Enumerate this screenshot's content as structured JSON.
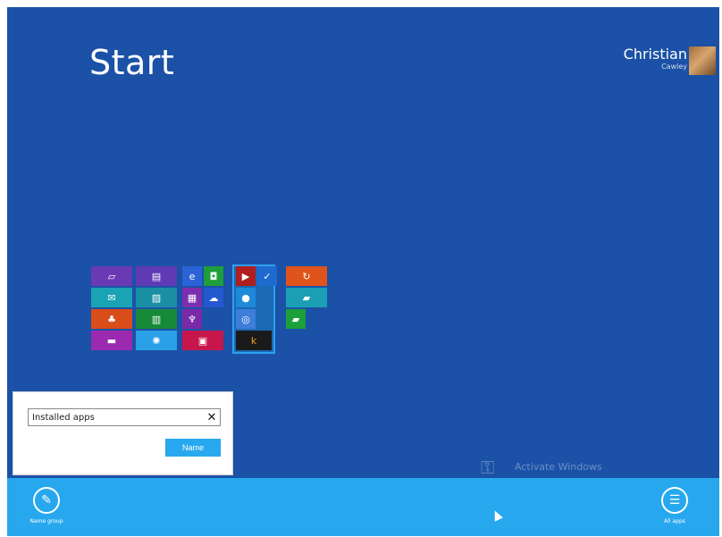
{
  "screen": {
    "title": "Start"
  },
  "user": {
    "name": "Christian",
    "subtitle": "Cawley"
  },
  "tiles": [
    {
      "name": "tile-photos",
      "color": "#6a3ab5",
      "glyph": "▱"
    },
    {
      "name": "tile-news",
      "color": "#5f3ab5",
      "glyph": "▤"
    },
    {
      "name": "tile-ie",
      "color": "#2b63d6",
      "glyph": "e"
    },
    {
      "name": "tile-store",
      "color": "#1e9e3a",
      "glyph": "◘"
    },
    {
      "name": "tile-mail",
      "color": "#1aa3b5",
      "glyph": "✉"
    },
    {
      "name": "tile-photos2",
      "color": "#1a8fa3",
      "glyph": "▨"
    },
    {
      "name": "tile-people",
      "color": "#7b2eb0",
      "glyph": "▦"
    },
    {
      "name": "tile-skydrive",
      "color": "#2358d0",
      "glyph": "☁"
    },
    {
      "name": "tile-people2",
      "color": "#d94d1a",
      "glyph": "♣"
    },
    {
      "name": "tile-finance",
      "color": "#178a3a",
      "glyph": "▥"
    },
    {
      "name": "tile-trophy",
      "color": "#7a2aa8",
      "glyph": "♆"
    },
    {
      "name": "tile-messaging",
      "color": "#9b2ab0",
      "glyph": "▬"
    },
    {
      "name": "tile-weather",
      "color": "#2aa0e8",
      "glyph": "✺"
    },
    {
      "name": "tile-reader",
      "color": "#c7164c",
      "glyph": "▣"
    },
    {
      "name": "tile-video",
      "color": "#b01e1e",
      "glyph": "▶"
    },
    {
      "name": "tile-check",
      "color": "#1e6ad0",
      "glyph": "✓"
    },
    {
      "name": "tile-skype",
      "color": "#1e8ad8",
      "glyph": "●"
    },
    {
      "name": "tile-chrome",
      "color": "#3c7ed8",
      "glyph": "◎"
    },
    {
      "name": "tile-app-k",
      "color": "#1a1a1a",
      "glyph": "k"
    },
    {
      "name": "tile-sync",
      "color": "#e0531a",
      "glyph": "↻"
    },
    {
      "name": "tile-camera",
      "color": "#1a9fb5",
      "glyph": "▰"
    },
    {
      "name": "tile-games",
      "color": "#1ba03a",
      "glyph": "▰"
    }
  ],
  "dialog": {
    "input_value": "Installed apps",
    "clear_label": "✕",
    "name_button": "Name"
  },
  "appbar": {
    "left_label": "Name group",
    "right_label": "All apps",
    "left_icon": "pencil-icon",
    "right_icon": "list-icon"
  },
  "watermark": {
    "text": "Activate Windows"
  }
}
